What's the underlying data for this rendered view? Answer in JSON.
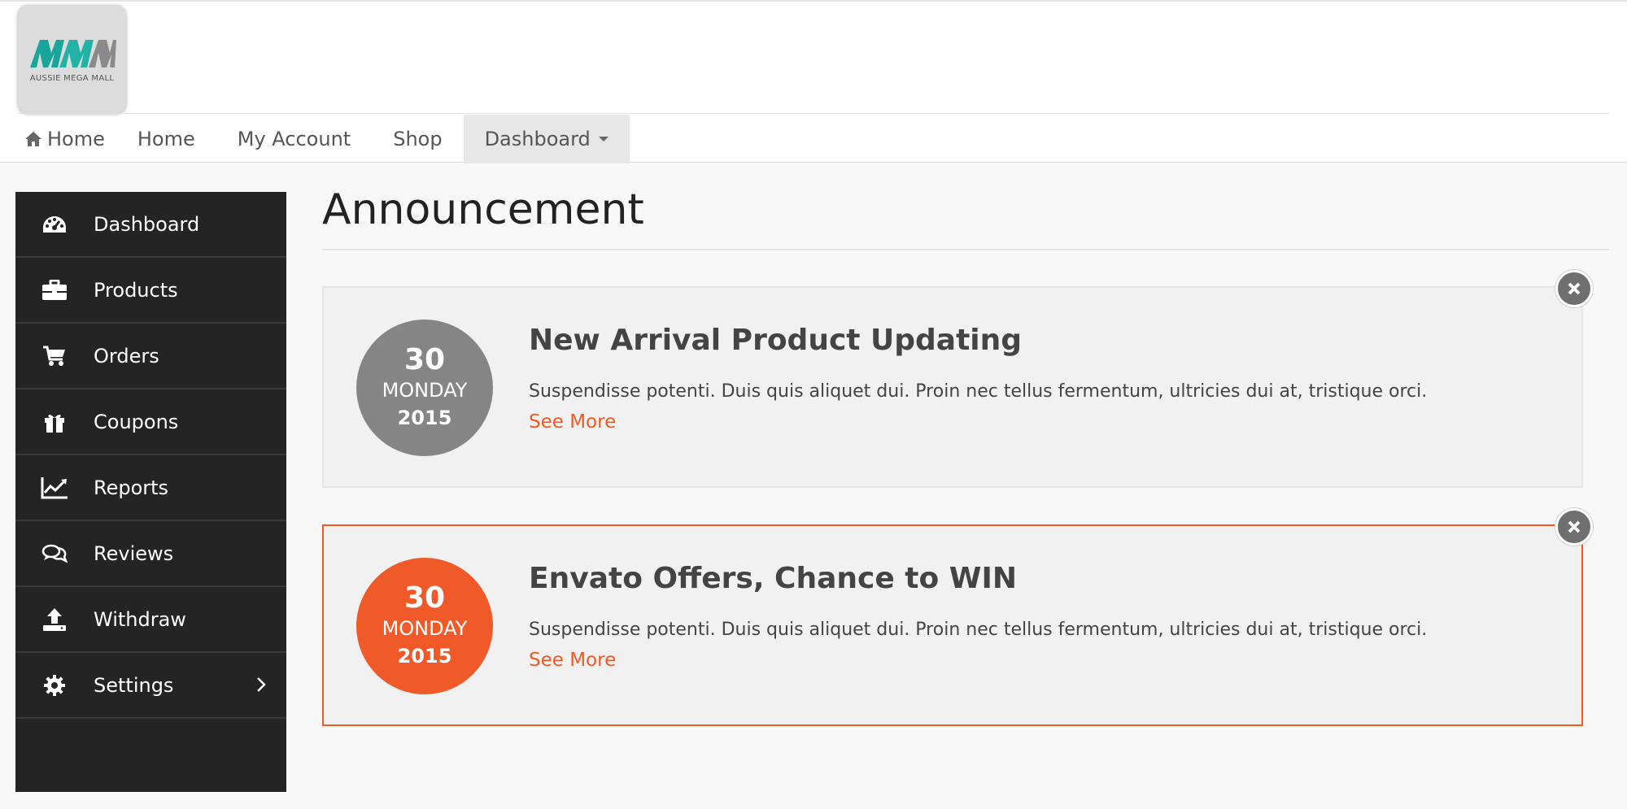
{
  "brand": {
    "logo_text": "AUSSIE MEGA MALL"
  },
  "nav": {
    "items": [
      {
        "label": "Home",
        "icon": "home-icon"
      },
      {
        "label": "Home"
      },
      {
        "label": "My Account"
      },
      {
        "label": "Shop"
      },
      {
        "label": "Dashboard",
        "active": true
      }
    ]
  },
  "sidebar": {
    "items": [
      {
        "label": "Dashboard",
        "icon": "dashboard-gauge-icon"
      },
      {
        "label": "Products",
        "icon": "briefcase-icon"
      },
      {
        "label": "Orders",
        "icon": "cart-icon"
      },
      {
        "label": "Coupons",
        "icon": "gift-icon"
      },
      {
        "label": "Reports",
        "icon": "line-chart-icon"
      },
      {
        "label": "Reviews",
        "icon": "comments-icon"
      },
      {
        "label": "Withdraw",
        "icon": "upload-icon"
      },
      {
        "label": "Settings",
        "icon": "gear-icon"
      }
    ]
  },
  "main": {
    "title": "Announcement",
    "announcements": [
      {
        "day": "30",
        "weekday": "MONDAY",
        "year": "2015",
        "title": "New Arrival Product Updating",
        "text": "Suspendisse potenti. Duis quis aliquet dui. Proin nec tellus fermentum, ultricies dui at, tristique orci.",
        "link": "See More",
        "circle_color": "#858585",
        "highlighted": false
      },
      {
        "day": "30",
        "weekday": "MONDAY",
        "year": "2015",
        "title": "Envato Offers, Chance to WIN",
        "text": "Suspendisse potenti. Duis quis aliquet dui. Proin nec tellus fermentum, ultricies dui at, tristique orci.",
        "link": "See More",
        "circle_color": "#f05a28",
        "highlighted": true
      }
    ]
  },
  "colors": {
    "accent": "#f05a28",
    "sidebar_bg": "#242424",
    "logo_teal": "#1aa59b"
  }
}
